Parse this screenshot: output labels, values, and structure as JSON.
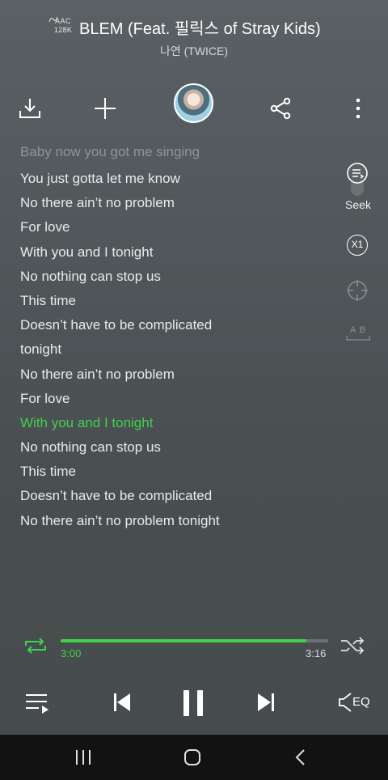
{
  "header": {
    "codec_top": "AAC",
    "codec_bottom": "128K",
    "title": "BLEM (Feat. 필릭스 of Stray Kids)",
    "artist": "나연 (TWICE)"
  },
  "toolbar": {
    "icons": [
      "download-icon",
      "add-icon",
      "album-art",
      "share-icon",
      "more-icon"
    ]
  },
  "lyrics": {
    "partial_line": "Baby now you got me singing",
    "lines": [
      "You just gotta let me know",
      "No there ain’t no problem",
      "For love",
      "With you and I tonight",
      "No nothing can stop us",
      "This time",
      "Doesn’t have to be complicated",
      "tonight",
      "No there ain’t no problem",
      "For love",
      "With you and I tonight",
      "No nothing can stop us",
      "This time",
      "Doesn’t have to be complicated",
      "No there ain’t no problem tonight"
    ],
    "active_index": 10
  },
  "side": {
    "seek_label": "Seek",
    "speed_label": "X1",
    "ab_label": "A B"
  },
  "progress": {
    "current": "3:00",
    "total": "3:16",
    "fraction": 0.918
  },
  "controls": {
    "eq_label": "EQ"
  },
  "colors": {
    "accent": "#3fd24a",
    "background": "#51575a",
    "navbar": "#121212"
  }
}
